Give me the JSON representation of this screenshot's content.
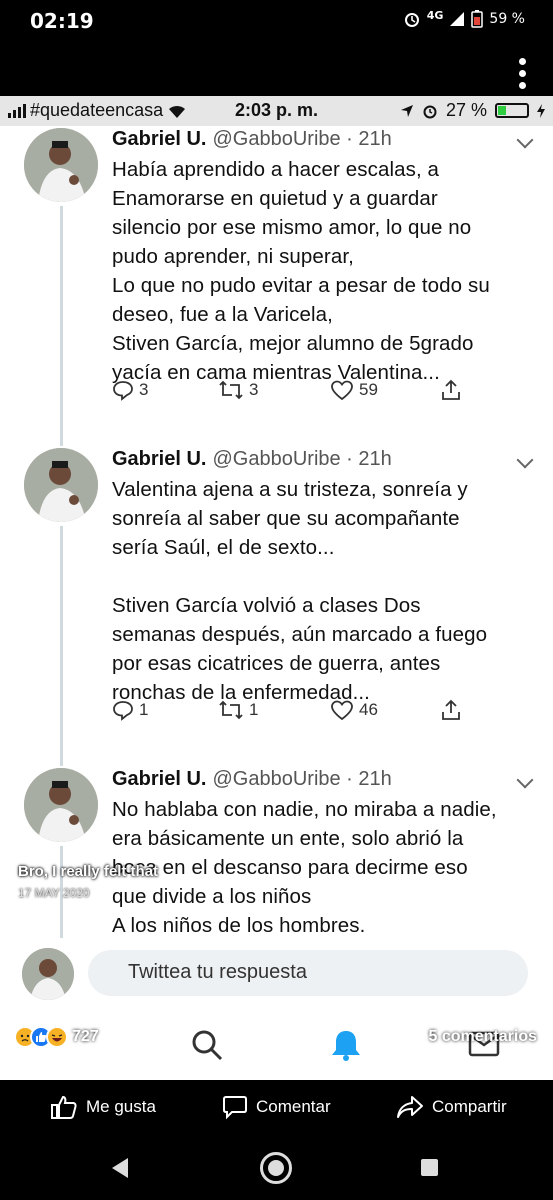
{
  "phone_status": {
    "time": "02:19",
    "network": "4G",
    "battery": "59 %"
  },
  "inner_status": {
    "carrier": "#quedateencasa",
    "time": "2:03 p. m.",
    "battery": "27 %"
  },
  "tweets": [
    {
      "name": "Gabriel U.",
      "handle": "@GabboUribe · 21h",
      "text": "Había aprendido a hacer escalas, a\nEnamorarse en quietud y a guardar\nsilencio por ese mismo amor, lo que no\npudo aprender, ni superar,\nLo que no pudo evitar a pesar de todo su\ndeseo, fue a la Varicela,\nStiven García, mejor alumno de 5grado\nyacía en cama mientras Valentina...",
      "replies": "3",
      "retweets": "3",
      "likes": "59"
    },
    {
      "name": "Gabriel U.",
      "handle": "@GabboUribe · 21h",
      "text": "Valentina ajena a su tristeza, sonreía y\nsonreía al saber que su acompañante\nsería Saúl, el de sexto...\n\nStiven García volvió a clases Dos\nsemanas después, aún marcado a fuego\npor esas cicatrices de guerra, antes\nronchas de la enfermedad...",
      "replies": "1",
      "retweets": "1",
      "likes": "46"
    },
    {
      "name": "Gabriel U.",
      "handle": "@GabboUribe · 21h",
      "text": "No hablaba con nadie, no miraba a nadie,\nera básicamente un ente, solo abrió la\nboca en el descanso para decirme eso\nque divide a los niños\nA los niños de los hombres.",
      "replies": "",
      "retweets": "",
      "likes": ""
    }
  ],
  "reply": {
    "placeholder": "Twittea tu respuesta"
  },
  "story": {
    "caption": "Bro, I really felt that",
    "date": "17 MAY 2020"
  },
  "post_stats": {
    "reactions_count": "727",
    "comments": "5 comentarios"
  },
  "post_actions": {
    "like": "Me gusta",
    "comment": "Comentar",
    "share": "Compartir"
  },
  "colors": {
    "twitter_blue": "#1da1f2",
    "facebook_blue": "#1877f2",
    "battery_green": "#2ecc40"
  }
}
